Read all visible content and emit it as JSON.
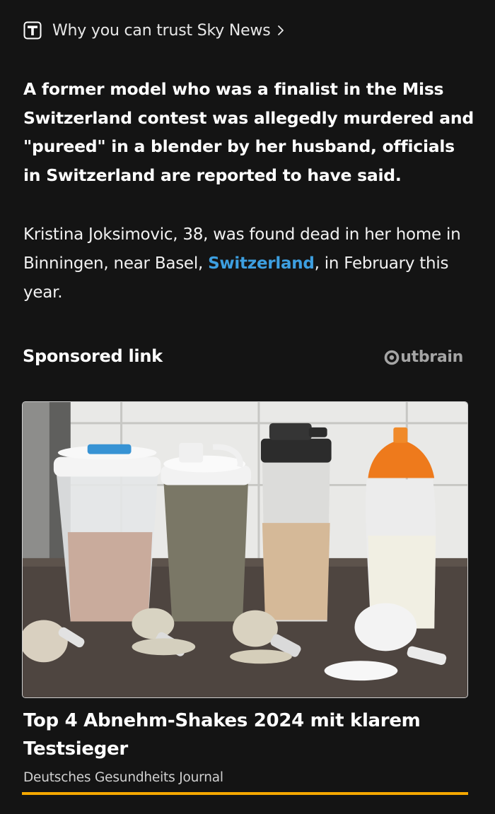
{
  "trust": {
    "label": "Why you can trust Sky News",
    "icon": "trust-t-icon",
    "chevron_icon": "chevron-right-icon"
  },
  "article": {
    "headline": "A former model who was a finalist in the Miss Switzerland contest was allegedly murdered and \"pureed\" in a blender by her husband, officials in Switzerland are reported to have said.",
    "paragraph": {
      "before_link": "Kristina Joksimovic, 38, was found dead in her home in Binningen, near Basel, ",
      "link_text": "Switzerland",
      "after_link": ", in February this year."
    }
  },
  "sponsored": {
    "label": "Sponsored link",
    "provider": "utbrain",
    "provider_icon": "outbrain-logo-icon"
  },
  "ad": {
    "image_icon": "protein-shakes-photo",
    "title": "Top 4 Abnehm-Shakes 2024 mit klarem Testsieger",
    "source": "Deutsches Gesundheits Journal"
  },
  "colors": {
    "background": "#141414",
    "link": "#3d9fe0",
    "ad_underline": "#f5a800",
    "outbrain": "#a5a5a5"
  }
}
